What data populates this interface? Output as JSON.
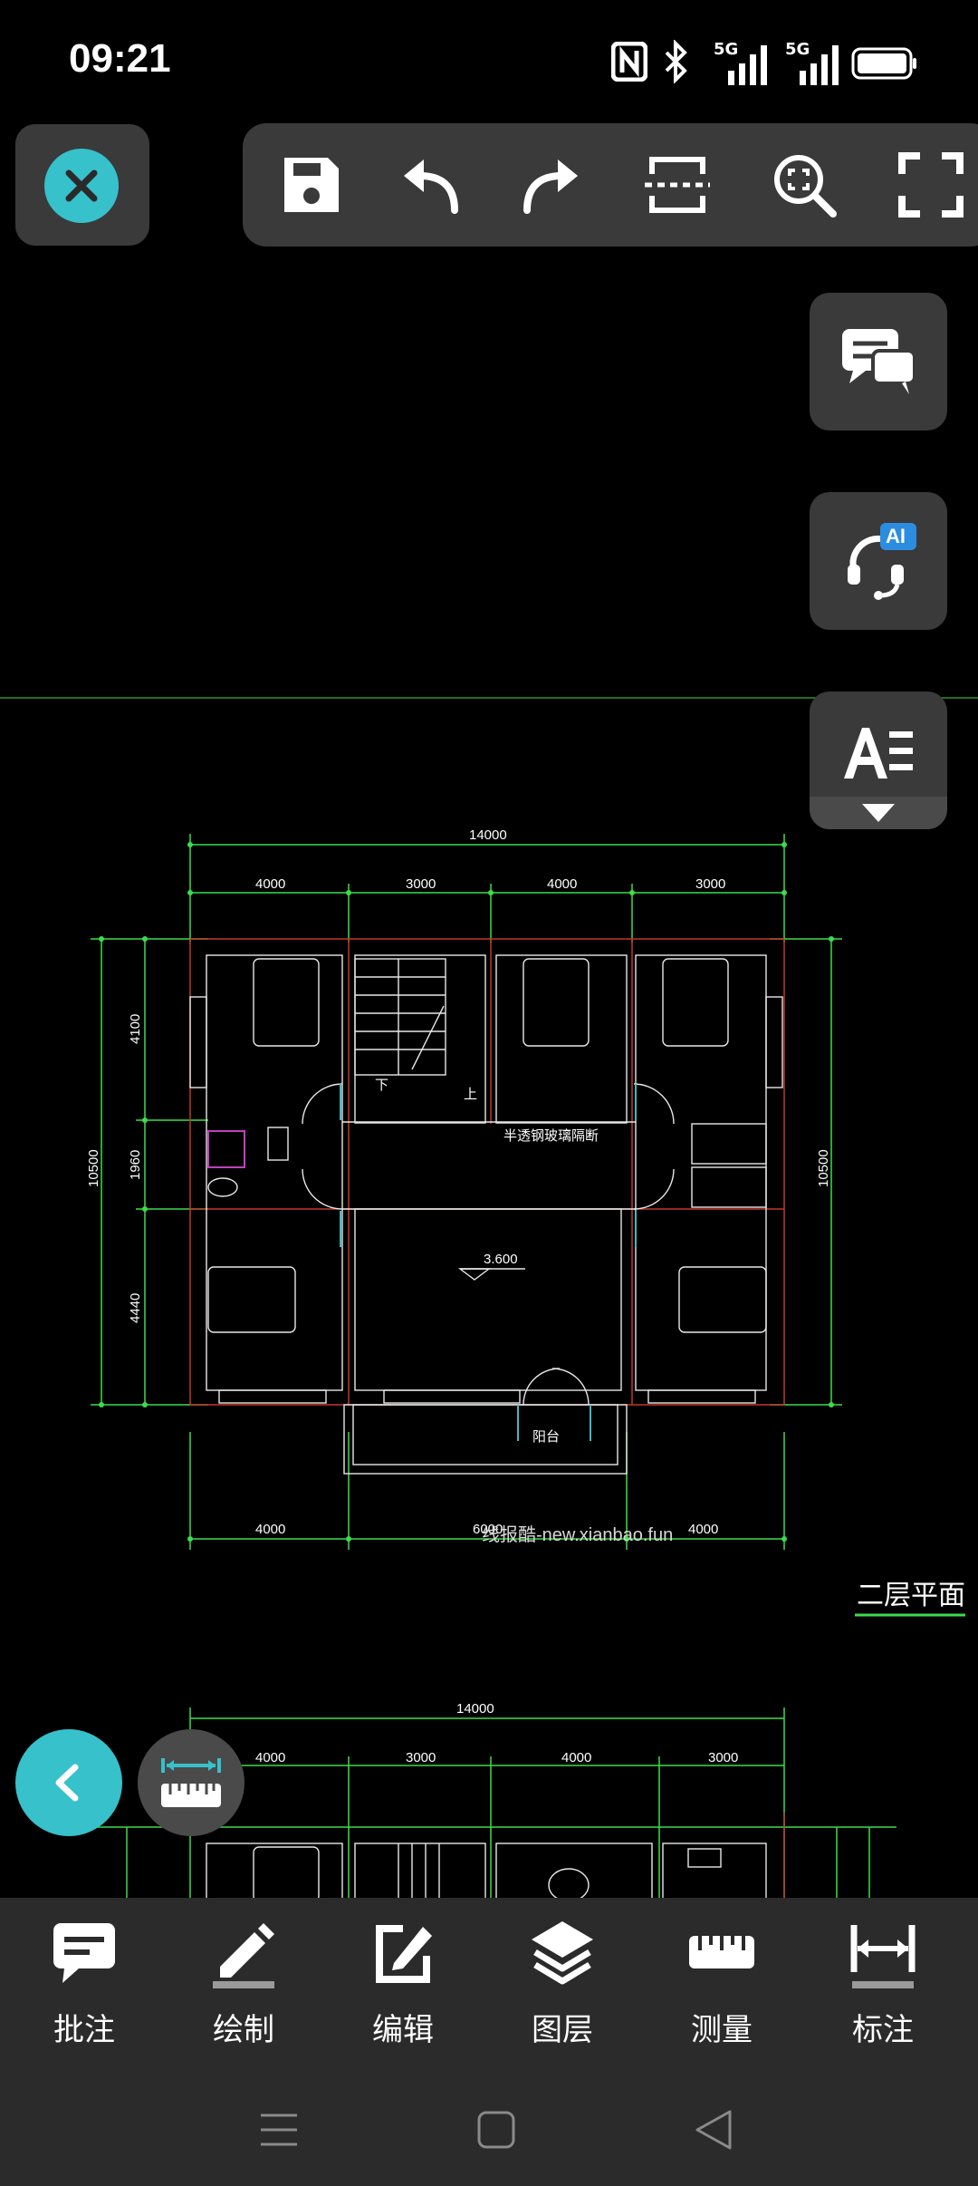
{
  "status_bar": {
    "time": "09:21",
    "net1": "5G",
    "net2": "5G"
  },
  "toolbar": {
    "items": [
      "save-icon",
      "undo-icon",
      "redo-icon",
      "crop-icon",
      "zoom-fit-icon",
      "fullscreen-icon"
    ]
  },
  "side_buttons": [
    "comments-icon",
    "ai-support-icon",
    "text-style-icon"
  ],
  "side_buttons_badge": "AI",
  "drawing": {
    "plan1": {
      "overall_width": "14000",
      "top_dims": [
        "4000",
        "3000",
        "4000",
        "3000"
      ],
      "left_total": "10500",
      "right_total": "10500",
      "left_dims": [
        "4100",
        "1960",
        "4440"
      ],
      "glass_partition": "半透钢玻璃隔断",
      "level": "3.600",
      "balcony": "阳台",
      "stair_down": "下",
      "stair_up": "上",
      "bottom_dims": [
        "4000",
        "6000",
        "4000"
      ],
      "title": "二层平面"
    },
    "watermark": "线报酷-new.xianbao.fun",
    "plan2": {
      "overall_width": "14000",
      "top_dims": [
        "4000",
        "3000",
        "4000",
        "3000"
      ]
    }
  },
  "bottom_bar": {
    "items": [
      {
        "icon": "annotation-icon",
        "label": "批注"
      },
      {
        "icon": "draw-icon",
        "label": "绘制"
      },
      {
        "icon": "edit-icon",
        "label": "编辑"
      },
      {
        "icon": "layers-icon",
        "label": "图层"
      },
      {
        "icon": "measure-icon",
        "label": "测量"
      },
      {
        "icon": "dimension-icon",
        "label": "标注"
      }
    ]
  },
  "colors": {
    "accent": "#36c1cb",
    "panel": "#3a3a3a",
    "bar": "#2b2b2b",
    "dim_line": "#3ddc4a",
    "wall": "#c0392b"
  }
}
